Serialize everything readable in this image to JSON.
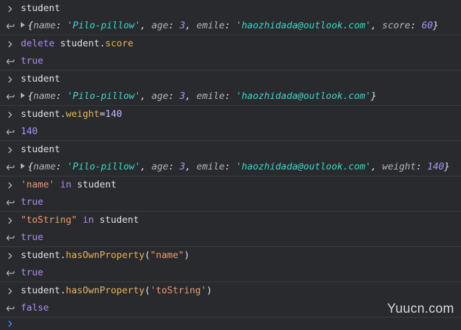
{
  "console": {
    "entries": [
      {
        "input": "student",
        "output": {
          "keys": [
            "name",
            "age",
            "emile",
            "score"
          ],
          "values": [
            "'Pilo-pillow'",
            "3",
            "'haozhidada@outlook.com'",
            "60"
          ]
        }
      },
      {
        "input_obj": "delete",
        "input_rest": "student.",
        "input_prop": "score",
        "output": "true"
      },
      {
        "input": "student",
        "output": {
          "keys": [
            "name",
            "age",
            "emile"
          ],
          "values": [
            "'Pilo-pillow'",
            "3",
            "'haozhidada@outlook.com'"
          ]
        }
      },
      {
        "input_obj": "student.",
        "input_prop": "weight",
        "input_op": "=",
        "input_num": "140",
        "output": "140"
      },
      {
        "input": "student",
        "output": {
          "keys": [
            "name",
            "age",
            "emile",
            "weight"
          ],
          "values": [
            "'Pilo-pillow'",
            "3",
            "'haozhidada@outlook.com'",
            "140"
          ]
        }
      },
      {
        "input_str": "'name'",
        "input_kw": " in ",
        "input_rest": "student",
        "output": "true"
      },
      {
        "input_str": "\"toString\"",
        "input_kw": " in ",
        "input_rest": "student",
        "output": "true"
      },
      {
        "input_obj": "student.",
        "input_fn": "hasOwnProperty",
        "input_open": "(",
        "input_arg": "\"name\"",
        "input_close": ")",
        "output": "true"
      },
      {
        "input_obj": "student.",
        "input_fn": "hasOwnProperty",
        "input_open": "(",
        "input_arg": "'toString'",
        "input_close": ")",
        "output": "false"
      }
    ]
  },
  "icons": {
    "input_prompt": "chevron-right-icon",
    "result_arrow": "return-arrow-icon",
    "expand": "expand-triangle-icon"
  },
  "colors": {
    "background": "#282a2e",
    "string": "#3ed8c8",
    "number": "#a497ff",
    "keyword": "#b28cf5",
    "property": "#eab45c",
    "string_literal": "#f59a6b"
  },
  "watermark": "Yuucn.com"
}
